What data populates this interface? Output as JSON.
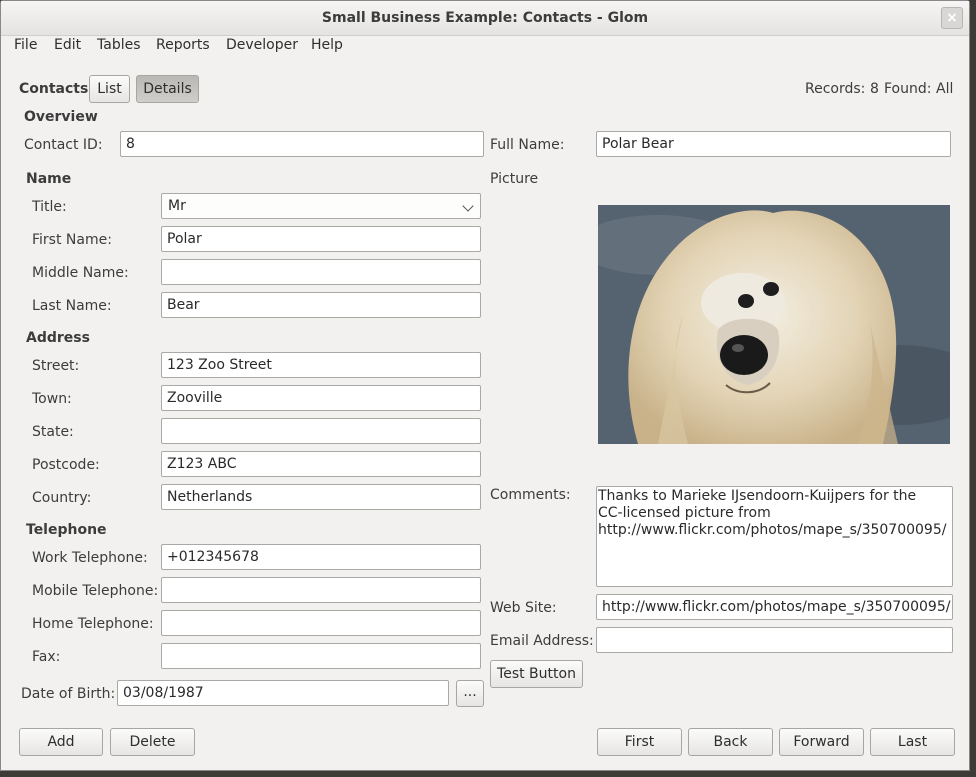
{
  "window": {
    "title": "Small Business Example: Contacts - Glom",
    "close_glyph": "×"
  },
  "menu": [
    "File",
    "Edit",
    "Tables",
    "Reports",
    "Developer",
    "Help"
  ],
  "toolbar": {
    "table_name": "Contacts",
    "list_label": "List",
    "details_label": "Details",
    "records_label": "Records:",
    "records_value": "8",
    "found_label": "Found:",
    "found_value": "All"
  },
  "overview": {
    "header": "Overview",
    "contact_id_label": "Contact ID:",
    "contact_id": "8",
    "full_name_label": "Full Name:",
    "full_name": "Polar Bear"
  },
  "name": {
    "header": "Name",
    "title_label": "Title:",
    "title": "Mr",
    "first_label": "First Name:",
    "first": "Polar",
    "middle_label": "Middle Name:",
    "middle": "",
    "last_label": "Last Name:",
    "last": "Bear"
  },
  "address": {
    "header": "Address",
    "street_label": "Street:",
    "street": "123 Zoo Street",
    "town_label": "Town:",
    "town": "Zooville",
    "state_label": "State:",
    "state": "",
    "postcode_label": "Postcode:",
    "postcode": "Z123 ABC",
    "country_label": "Country:",
    "country": "Netherlands"
  },
  "telephone": {
    "header": "Telephone",
    "work_label": "Work Telephone:",
    "work": "+012345678",
    "mobile_label": "Mobile Telephone:",
    "mobile": "",
    "home_label": "Home Telephone:",
    "home": "",
    "fax_label": "Fax:",
    "fax": ""
  },
  "dob": {
    "label": "Date of Birth:",
    "value": "03/08/1987",
    "picker_label": "..."
  },
  "picture": {
    "label": "Picture"
  },
  "comments": {
    "label": "Comments:",
    "lines": [
      "Thanks to Marieke IJsendoorn-Kuijpers for the",
      "CC-licensed picture from",
      "http://www.flickr.com/photos/mape_s/350700095/"
    ]
  },
  "website": {
    "label": "Web Site:",
    "value": "http://www.flickr.com/photos/mape_s/350700095/"
  },
  "email": {
    "label": "Email Address:",
    "value": ""
  },
  "test_button_label": "Test Button",
  "buttons": {
    "add": "Add",
    "delete": "Delete",
    "first": "First",
    "back": "Back",
    "forward": "Forward",
    "last": "Last"
  }
}
